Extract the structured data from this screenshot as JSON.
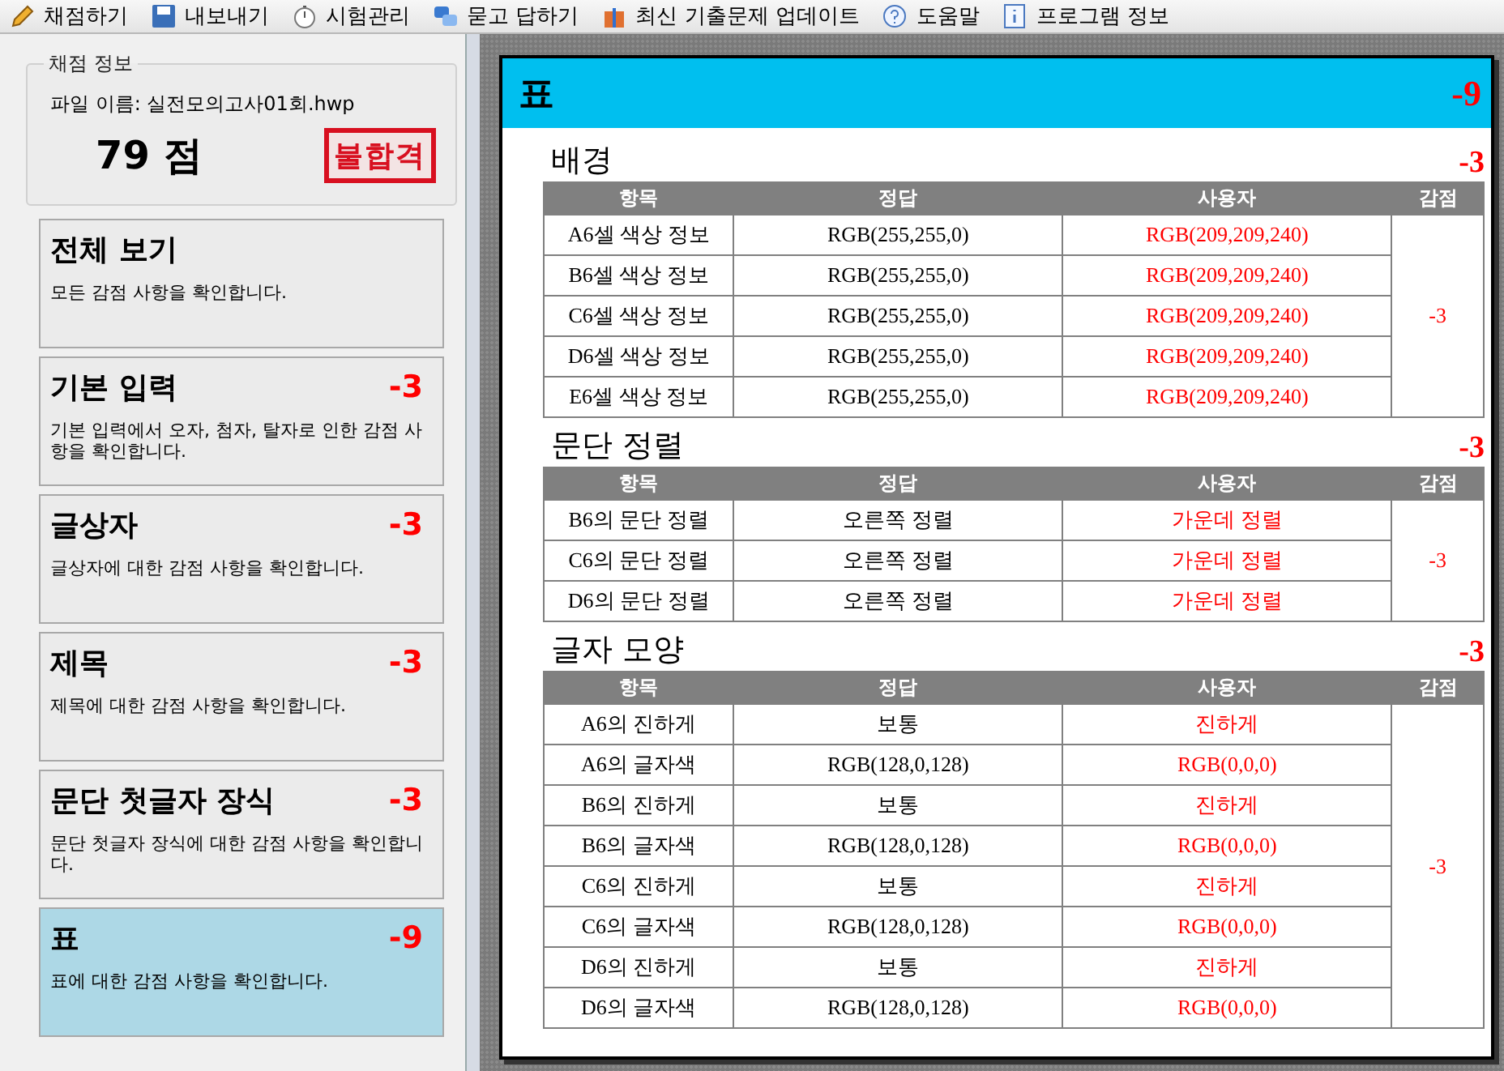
{
  "toolbar": [
    {
      "label": "채점하기",
      "kind": "pencil"
    },
    {
      "label": "내보내기",
      "kind": "disk"
    },
    {
      "label": "시험관리",
      "kind": "clock"
    },
    {
      "label": "묻고 답하기",
      "kind": "chat"
    },
    {
      "label": "최신 기출문제 업데이트",
      "kind": "gift"
    },
    {
      "label": "도움말",
      "kind": "help"
    },
    {
      "label": "프로그램 정보",
      "kind": "info"
    }
  ],
  "score_info": {
    "group_title": "채점 정보",
    "file_name": "파일 이름: 실전모의고사01회.hwp",
    "score": "79 점",
    "result_stamp": "불합격"
  },
  "categories": [
    {
      "title": "전체 보기",
      "description": "모든 감점 사항을 확인합니다.",
      "selected": false
    },
    {
      "title": "기본 입력",
      "deduction": "-3",
      "description": "기본 입력에서 오자, 첨자, 탈자로 인한 감점 사항을 확인합니다.",
      "selected": false
    },
    {
      "title": "글상자",
      "deduction": "-3",
      "description": "글상자에 대한 감점 사항을 확인합니다.",
      "selected": false
    },
    {
      "title": "제목",
      "deduction": "-3",
      "description": "제목에 대한 감점 사항을 확인합니다.",
      "selected": false
    },
    {
      "title": "문단 첫글자 장식",
      "deduction": "-3",
      "description": "문단 첫글자 장식에 대한 감점 사항을 확인합니다.",
      "selected": false
    },
    {
      "title": "표",
      "deduction": "-9",
      "description": "표에 대한 감점 사항을 확인합니다.",
      "selected": true
    }
  ],
  "report": {
    "title": "표",
    "deduction": "-9",
    "sections": [
      {
        "title": "배경",
        "deduction": "-3",
        "columns": [
          "항목",
          "정답",
          "사용자",
          "감점"
        ],
        "row_deduction": "-3",
        "rows": [
          {
            "item": "A6셀 색상 정보",
            "answer": "RGB(255,255,0)",
            "user": "RGB(209,209,240)"
          },
          {
            "item": "B6셀 색상 정보",
            "answer": "RGB(255,255,0)",
            "user": "RGB(209,209,240)"
          },
          {
            "item": "C6셀 색상 정보",
            "answer": "RGB(255,255,0)",
            "user": "RGB(209,209,240)"
          },
          {
            "item": "D6셀 색상 정보",
            "answer": "RGB(255,255,0)",
            "user": "RGB(209,209,240)"
          },
          {
            "item": "E6셀 색상 정보",
            "answer": "RGB(255,255,0)",
            "user": "RGB(209,209,240)"
          }
        ]
      },
      {
        "title": "문단 정렬",
        "deduction": "-3",
        "columns": [
          "항목",
          "정답",
          "사용자",
          "감점"
        ],
        "row_deduction": "-3",
        "rows": [
          {
            "item": "B6의 문단 정렬",
            "answer": "오른쪽 정렬",
            "user": "가운데 정렬"
          },
          {
            "item": "C6의 문단 정렬",
            "answer": "오른쪽 정렬",
            "user": "가운데 정렬"
          },
          {
            "item": "D6의 문단 정렬",
            "answer": "오른쪽 정렬",
            "user": "가운데 정렬"
          }
        ]
      },
      {
        "title": "글자 모양",
        "deduction": "-3",
        "columns": [
          "항목",
          "정답",
          "사용자",
          "감점"
        ],
        "row_deduction": "-3",
        "rows": [
          {
            "item": "A6의 진하게",
            "answer": "보통",
            "user": "진하게"
          },
          {
            "item": "A6의 글자색",
            "answer": "RGB(128,0,128)",
            "user": "RGB(0,0,0)"
          },
          {
            "item": "B6의 진하게",
            "answer": "보통",
            "user": "진하게"
          },
          {
            "item": "B6의 글자색",
            "answer": "RGB(128,0,128)",
            "user": "RGB(0,0,0)"
          },
          {
            "item": "C6의 진하게",
            "answer": "보통",
            "user": "진하게"
          },
          {
            "item": "C6의 글자색",
            "answer": "RGB(128,0,128)",
            "user": "RGB(0,0,0)"
          },
          {
            "item": "D6의 진하게",
            "answer": "보통",
            "user": "진하게"
          },
          {
            "item": "D6의 글자색",
            "answer": "RGB(128,0,128)",
            "user": "RGB(0,0,0)"
          }
        ]
      }
    ]
  }
}
